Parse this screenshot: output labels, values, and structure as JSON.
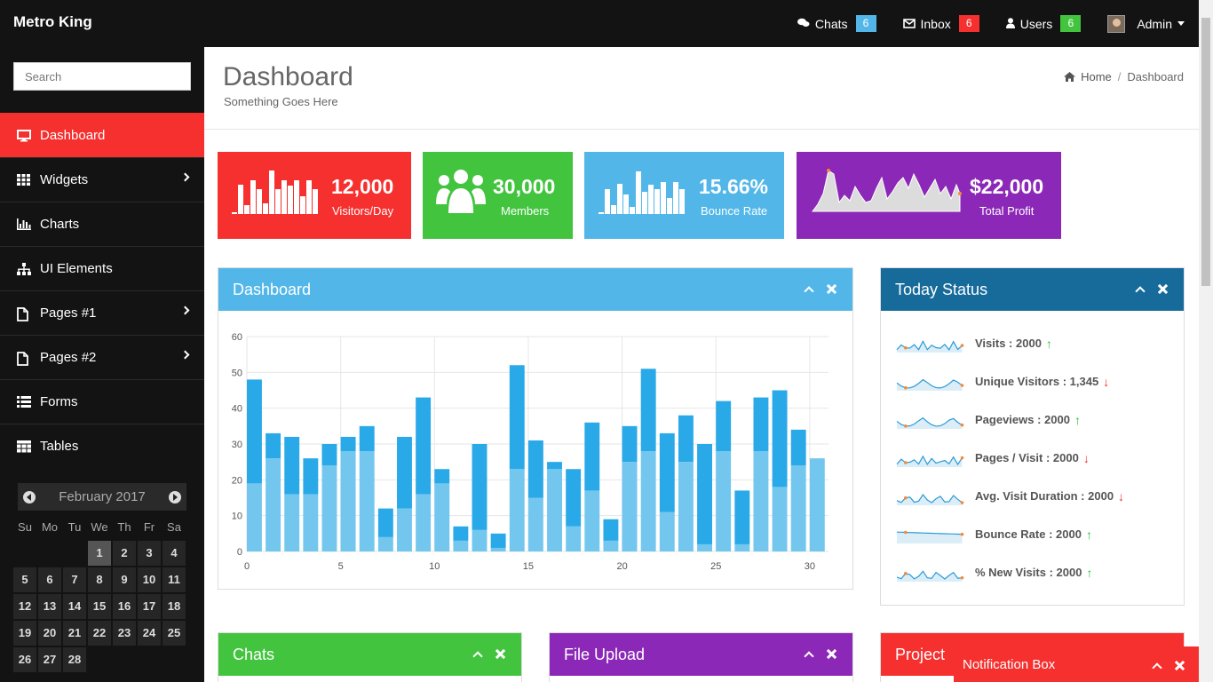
{
  "header": {
    "brand": "Metro King",
    "chats_label": "Chats",
    "chats_count": "6",
    "inbox_label": "Inbox",
    "inbox_count": "6",
    "users_label": "Users",
    "users_count": "6",
    "admin_label": "Admin"
  },
  "sidebar": {
    "search_placeholder": "Search",
    "items": [
      {
        "label": "Dashboard",
        "icon": "desktop-icon"
      },
      {
        "label": "Widgets",
        "icon": "grid-icon"
      },
      {
        "label": "Charts",
        "icon": "bar-chart-icon"
      },
      {
        "label": "UI Elements",
        "icon": "sitemap-icon"
      },
      {
        "label": "Pages #1",
        "icon": "file-icon"
      },
      {
        "label": "Pages #2",
        "icon": "file-icon"
      },
      {
        "label": "Forms",
        "icon": "list-icon"
      },
      {
        "label": "Tables",
        "icon": "table-icon"
      }
    ],
    "calendar": {
      "month": "February 2017",
      "dows": [
        "Su",
        "Mo",
        "Tu",
        "We",
        "Th",
        "Fr",
        "Sa"
      ],
      "days": [
        "",
        "",
        "",
        "1",
        "2",
        "3",
        "4",
        "5",
        "6",
        "7",
        "8",
        "9",
        "10",
        "11",
        "12",
        "13",
        "14",
        "15",
        "16",
        "17",
        "18",
        "19",
        "20",
        "21",
        "22",
        "23",
        "24",
        "25",
        "26",
        "27",
        "28"
      ]
    }
  },
  "page": {
    "title": "Dashboard",
    "subtitle": "Something Goes Here",
    "crumb_home": "Home",
    "crumb_current": "Dashboard"
  },
  "stats": [
    {
      "value": "12,000",
      "label": "Visitors/Day",
      "color": "#f5302e"
    },
    {
      "value": "30,000",
      "label": "Members",
      "color": "#43c43f"
    },
    {
      "value": "15.66%",
      "label": "Bounce Rate",
      "color": "#52b7e8"
    },
    {
      "value": "$22,000",
      "label": "Total Profit",
      "color": "#8c28b8"
    }
  ],
  "panels": {
    "dashboard_title": "Dashboard",
    "status_title": "Today Status",
    "chats_title": "Chats",
    "upload_title": "File Upload",
    "project_title": "Project",
    "notification_title": "Notification Box"
  },
  "today_status": [
    {
      "label": "Visits : 2000",
      "trend": "up"
    },
    {
      "label": "Unique Visitors : 1,345",
      "trend": "down"
    },
    {
      "label": "Pageviews : 2000",
      "trend": "up"
    },
    {
      "label": "Pages / Visit : 2000",
      "trend": "down"
    },
    {
      "label": "Avg. Visit Duration : 2000",
      "trend": "down"
    },
    {
      "label": "Bounce Rate : 2000",
      "trend": "up"
    },
    {
      "label": "% New Visits : 2000",
      "trend": "up"
    }
  ],
  "colors": {
    "accent_red": "#f5302e",
    "green": "#43c43f",
    "light_blue": "#52b7e8",
    "purple": "#8c28b8",
    "dark_blue": "#176b9b",
    "chart_dark": "#29a9e8",
    "chart_light": "#73c7ee"
  },
  "chart_data": {
    "type": "bar",
    "stacked": true,
    "x": [
      0,
      1,
      2,
      3,
      4,
      5,
      6,
      7,
      8,
      9,
      10,
      11,
      12,
      13,
      14,
      15,
      16,
      17,
      18,
      19,
      20,
      21,
      22,
      23,
      24,
      25,
      26,
      27,
      28,
      29,
      30
    ],
    "series": [
      {
        "values": [
          19,
          26,
          16,
          16,
          24,
          28,
          28,
          4,
          12,
          16,
          19,
          3,
          6,
          1,
          23,
          15,
          23,
          7,
          17,
          3,
          25,
          28,
          11,
          25,
          2,
          28,
          2,
          28,
          18,
          24,
          26
        ]
      },
      {
        "values": [
          29,
          7,
          16,
          10,
          6,
          4,
          7,
          8,
          20,
          27,
          4,
          4,
          24,
          4,
          29,
          16,
          2,
          16,
          19,
          6,
          10,
          23,
          22,
          13,
          28,
          14,
          15,
          15,
          27,
          10,
          0
        ]
      }
    ],
    "xlim": [
      0,
      31
    ],
    "ylim": [
      0,
      60
    ],
    "xticks": [
      0,
      5,
      10,
      15,
      20,
      25,
      30
    ],
    "yticks": [
      0,
      10,
      20,
      30,
      40,
      50,
      60
    ],
    "grid": true
  }
}
